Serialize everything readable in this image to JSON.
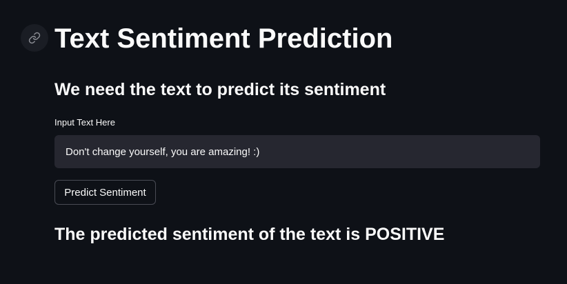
{
  "header": {
    "anchor_icon": "link-icon",
    "title": "Text Sentiment Prediction"
  },
  "main": {
    "subtitle": "We need the text to predict its sentiment",
    "input": {
      "label": "Input Text Here",
      "value": "Don't change yourself, you are amazing! :)"
    },
    "button_label": "Predict Sentiment",
    "result": "The predicted sentiment of the text is POSITIVE"
  },
  "colors": {
    "background": "#0e1117",
    "input_background": "#262730",
    "text": "#fafafa"
  }
}
